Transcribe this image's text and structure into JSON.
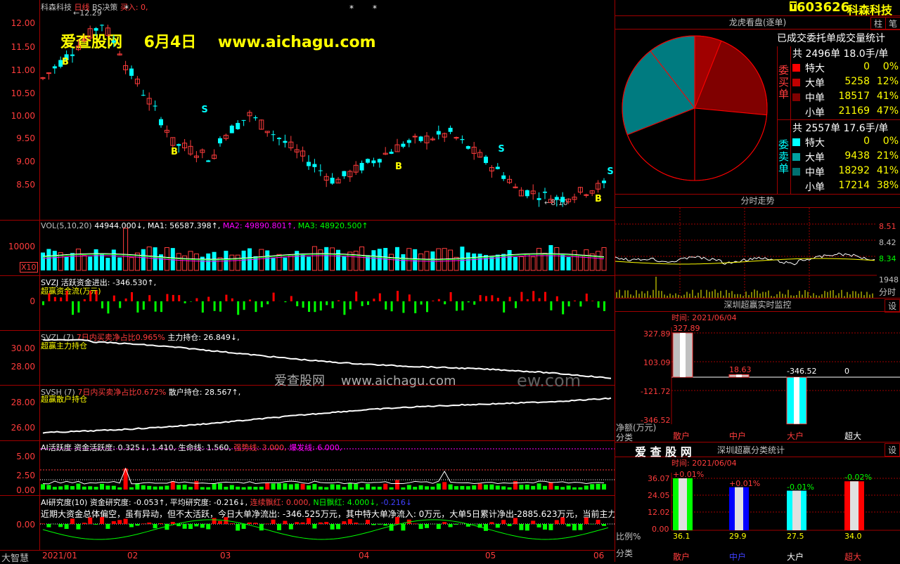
{
  "stock": {
    "code": "603626",
    "name": "科森科技",
    "buttons": [
      "柱",
      "笔"
    ],
    "marker": "T"
  },
  "price_panel": {
    "title_name": "科森科技",
    "title_tag": "日线",
    "title_rest": "BS决策",
    "title_buy": "买入: 0,",
    "high_label": "←12.29",
    "low_label": "←8.10",
    "ticks": [
      "12.00",
      "11.50",
      "11.00",
      "10.50",
      "10.00",
      "9.50",
      "9.00",
      "8.50"
    ],
    "watermark": "爱查股网    6月4日    www.aichagu.com",
    "signals": [
      "B",
      "B",
      "S",
      "B",
      "S",
      "B",
      "S"
    ]
  },
  "vol_panel": {
    "title": "VOL(5,10,20)",
    "vol": "44944.000↓,",
    "ma1": "MA1: 56587.398↑,",
    "ma2": "MA2: 49890.801↑,",
    "ma3": "MA3: 48920.500↑",
    "tick": "10000",
    "unit": "X10"
  },
  "svzj_panel": {
    "title": "SVZJ  活跃资金进出: -346.530↑,",
    "subtitle": "超赢资金流(万元)",
    "tick": "0"
  },
  "svzl_panel": {
    "title_a": "SVZL (7)",
    "title_b": "7日内买卖净占比0.965%",
    "title_c": "主力持仓: 26.849↓,",
    "subtitle": "超赢主力持仓",
    "ticks": [
      "30.00",
      "28.00"
    ]
  },
  "svsh_panel": {
    "title_a": "SVSH (7)",
    "title_b": "7日内买卖净占比0.672%",
    "title_c": "散户持仓: 28.567↑,",
    "subtitle": "超赢散户持仓",
    "ticks": [
      "28.00",
      "26.00"
    ]
  },
  "center_watermark": "爱查股网    www.aichagu.com",
  "center_watermark2": "ew.com",
  "ai_panel": {
    "title_a": "AI活跃度  资金活跃度: 0.325↓,",
    "title_b": "1.410,",
    "title_c": "生命线: 1.560,",
    "title_d": "强势线: 3.000,",
    "title_e": "爆发线: 6.000,",
    "ticks": [
      "5.00",
      "2.50",
      "0.00"
    ]
  },
  "research_panel": {
    "title_a": "AI研究度(10) 资金研究度: -0.053↑,",
    "title_b": "平均研究度: -0.216↓,",
    "title_c": "连续飘红: 0.000,",
    "title_d": "N日飘红: 4.000↓,",
    "title_e": "-0.216↓",
    "comment": "近期大资金总体偏空，虽有异动，但不太活跃，今日大单净流出: -346.525万元，其中特大单净流入: 0万元，大单5日累计净出-2885.623万元，当前主力控",
    "tick": "0.00"
  },
  "bottom_label": "大智慧",
  "x_axis": [
    "2021/01",
    "02",
    "03",
    "04",
    "05",
    "06"
  ],
  "pie_panel": {
    "header": "龙虎看盘(逐单)",
    "sub_header": "已成交委托单成交量统计",
    "buy_label": "委买单",
    "sell_label": "委卖单",
    "buy_total": "共 2496单 18.0手/单",
    "sell_total": "共 2557单 17.6手/单",
    "buy_rows": [
      {
        "label": "特大",
        "value": "0",
        "pct": "0%",
        "color": "#ff0000"
      },
      {
        "label": "大单",
        "value": "5258",
        "pct": "12%",
        "color": "#c00000"
      },
      {
        "label": "中单",
        "value": "18517",
        "pct": "41%",
        "color": "#800000"
      },
      {
        "label": "小单",
        "value": "21169",
        "pct": "47%",
        "color": "#000000"
      }
    ],
    "sell_rows": [
      {
        "label": "特大",
        "value": "0",
        "pct": "0%",
        "color": "#00ffff"
      },
      {
        "label": "大单",
        "value": "9438",
        "pct": "21%",
        "color": "#00a0a0"
      },
      {
        "label": "中单",
        "value": "18292",
        "pct": "41%",
        "color": "#007070"
      },
      {
        "label": "小单",
        "value": "17214",
        "pct": "38%",
        "color": "#000000"
      }
    ]
  },
  "minute_panel": {
    "header": "分时走势",
    "ticks": [
      "8.51",
      "8.42",
      "8.34"
    ],
    "vol_tick": "1948",
    "vol_label": "分时"
  },
  "monitor_panel": {
    "header": "深圳超赢实时监控",
    "settings": "设",
    "date": "时间: 2021/06/04",
    "ticks": [
      "327.89",
      "103.09",
      "-121.72",
      "-346.52"
    ],
    "bars": [
      {
        "label": "散户",
        "value": "327.89"
      },
      {
        "label": "中户",
        "value": "18.63"
      },
      {
        "label": "大户",
        "value": "-346.52"
      },
      {
        "label": "超大",
        "value": "0"
      }
    ],
    "y_label": "净额(万元)",
    "x_label": "分类"
  },
  "stats_panel": {
    "brand": "爱 查 股 网",
    "header": "深圳超赢分类统计",
    "settings": "设",
    "date": "时间: 2021/06/04",
    "ticks": [
      "36.07",
      "24.05",
      "12.02",
      "0.00"
    ],
    "bars": [
      {
        "label": "散户",
        "value": "36.1",
        "delta": "+0.01%",
        "color": "#00ff00"
      },
      {
        "label": "中户",
        "value": "29.9",
        "delta": "+0.01%",
        "color": "#0000ff"
      },
      {
        "label": "大户",
        "value": "27.5",
        "delta": "-0.01%",
        "color": "#00ffff"
      },
      {
        "label": "超大",
        "value": "34.0",
        "delta": "-0.02%",
        "color": "#ff0000"
      }
    ],
    "y_label": "比例%",
    "x_label": "分类"
  }
}
